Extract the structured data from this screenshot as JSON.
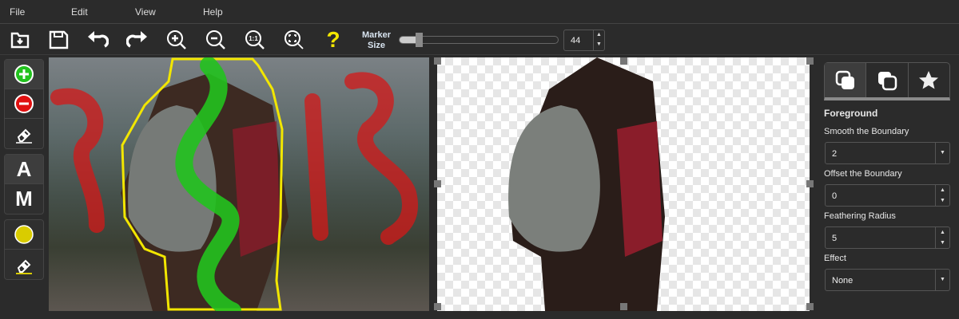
{
  "menu": {
    "file": "File",
    "edit": "Edit",
    "view": "View",
    "help": "Help"
  },
  "toolbar": {
    "help": "?",
    "marker_label_1": "Marker",
    "marker_label_2": "Size",
    "marker_size": "44",
    "marker_fraction": 0.1
  },
  "left_tools": {
    "auto": "A",
    "manual": "M"
  },
  "panel": {
    "section": "Foreground",
    "smooth_label": "Smooth the Boundary",
    "smooth_value": "2",
    "offset_label": "Offset the Boundary",
    "offset_value": "0",
    "feather_label": "Feathering Radius",
    "feather_value": "5",
    "effect_label": "Effect",
    "effect_value": "None"
  },
  "colors": {
    "keep": "#22c21e",
    "remove": "#e01010",
    "boundary": "#f2e600"
  }
}
